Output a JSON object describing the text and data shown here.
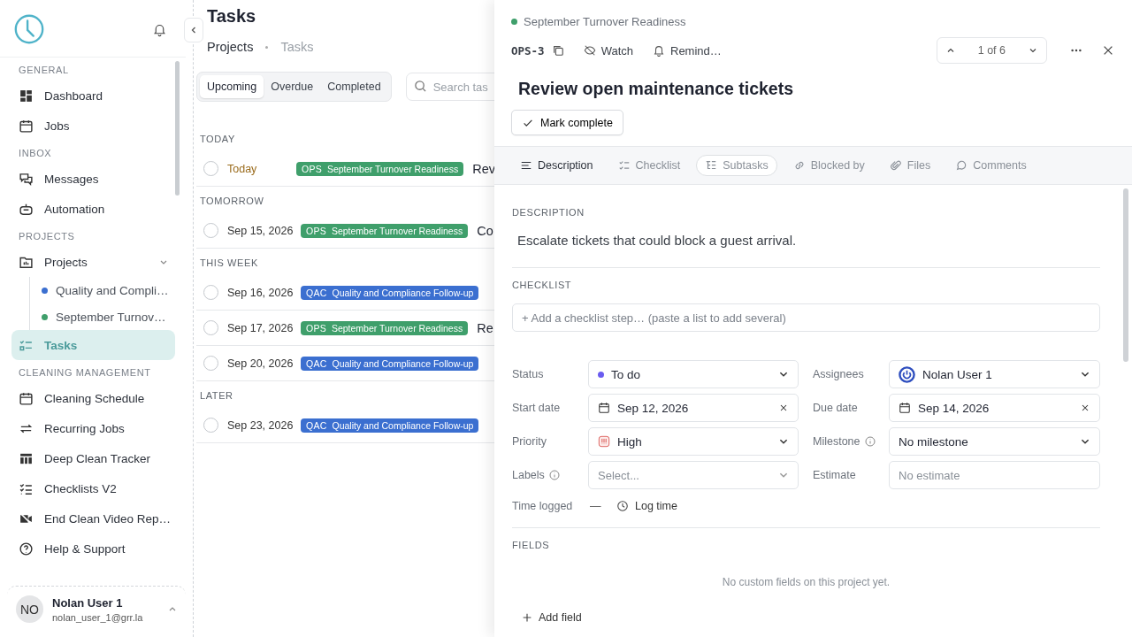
{
  "sidebar": {
    "sections": [
      {
        "heading": "GENERAL",
        "items": [
          {
            "label": "Dashboard",
            "selected": false
          },
          {
            "label": "Jobs",
            "selected": false
          }
        ]
      },
      {
        "heading": "INBOX",
        "items": [
          {
            "label": "Messages",
            "selected": false
          },
          {
            "label": "Automation",
            "selected": false
          }
        ]
      },
      {
        "heading": "PROJECTS",
        "items": [
          {
            "label": "Projects",
            "selected": false,
            "expanded": true,
            "children": [
              {
                "label": "Quality and Compli…",
                "color": "#3b6fd0",
                "selected": false
              },
              {
                "label": "September Turnov…",
                "color": "#3f9f6b",
                "selected": false
              }
            ]
          },
          {
            "label": "Tasks",
            "selected": true
          }
        ]
      },
      {
        "heading": "CLEANING MANAGEMENT",
        "items": [
          {
            "label": "Cleaning Schedule",
            "selected": false
          },
          {
            "label": "Recurring Jobs",
            "selected": false
          },
          {
            "label": "Deep Clean Tracker",
            "selected": false
          },
          {
            "label": "Checklists V2",
            "selected": false
          },
          {
            "label": "End Clean Video Rep…",
            "selected": false
          },
          {
            "label": "Help & Support",
            "selected": false
          }
        ]
      }
    ],
    "user": {
      "initials": "NO",
      "name": "Nolan User 1",
      "email": "nolan_user_1@grr.la"
    }
  },
  "main": {
    "title": "Tasks",
    "breadcrumb": [
      {
        "label": "Projects",
        "selected": false
      },
      {
        "label": "Tasks",
        "selected": true
      }
    ],
    "tabs": [
      {
        "label": "Upcoming",
        "selected": true
      },
      {
        "label": "Overdue",
        "selected": false
      },
      {
        "label": "Completed",
        "selected": false
      }
    ],
    "search": {
      "placeholder": "Search tas"
    },
    "groups": [
      {
        "heading": "TODAY",
        "rows": [
          {
            "checked": false,
            "date": "Today",
            "kind": "today",
            "tag": {
              "code": "OPS",
              "project": "September Turnover Readiness",
              "color": "#3f9f6b"
            },
            "title": "Rev"
          }
        ]
      },
      {
        "heading": "TOMORROW",
        "rows": [
          {
            "checked": false,
            "date": "Sep 15, 2026",
            "kind": "date",
            "tag": {
              "code": "OPS",
              "project": "September Turnover Readiness",
              "color": "#3f9f6b"
            },
            "title": "Co"
          }
        ]
      },
      {
        "heading": "THIS WEEK",
        "rows": [
          {
            "checked": false,
            "date": "Sep 16, 2026",
            "kind": "date",
            "tag": {
              "code": "QAC",
              "project": "Quality and Compliance Follow-up",
              "color": "#3b6fd0"
            }
          },
          {
            "checked": false,
            "date": "Sep 17, 2026",
            "kind": "date",
            "tag": {
              "code": "OPS",
              "project": "September Turnover Readiness",
              "color": "#3f9f6b"
            },
            "title": "Re"
          },
          {
            "checked": false,
            "date": "Sep 20, 2026",
            "kind": "date",
            "tag": {
              "code": "QAC",
              "project": "Quality and Compliance Follow-up",
              "color": "#3b6fd0"
            }
          }
        ]
      },
      {
        "heading": "LATER",
        "rows": [
          {
            "checked": false,
            "date": "Sep 23, 2026",
            "kind": "date",
            "tag": {
              "code": "QAC",
              "project": "Quality and Compliance Follow-up",
              "color": "#3b6fd0"
            }
          }
        ]
      }
    ]
  },
  "detail": {
    "project": {
      "name": "September Turnover Readiness",
      "color": "#3f9f6b"
    },
    "key": "OPS-3",
    "watch": "Watch",
    "remind": "Remind…",
    "pager": "1 of 6",
    "title": "Review open maintenance tickets",
    "complete_button": "Mark complete",
    "tabs": [
      {
        "label": "Description",
        "selected": true,
        "focused": false
      },
      {
        "label": "Checklist",
        "selected": false,
        "focused": false
      },
      {
        "label": "Subtasks",
        "selected": false,
        "focused": true
      },
      {
        "label": "Blocked by",
        "selected": false,
        "focused": false
      },
      {
        "label": "Files",
        "selected": false,
        "focused": false
      },
      {
        "label": "Comments",
        "selected": false,
        "focused": false
      }
    ],
    "description": {
      "heading": "DESCRIPTION",
      "text": "Escalate tickets that could block a guest arrival."
    },
    "checklist": {
      "heading": "CHECKLIST",
      "placeholder": "+ Add a checklist step… (paste a list to add several)"
    },
    "properties": [
      {
        "label": "Status",
        "info": false,
        "kind": "status",
        "value": "To do",
        "color": "#6a5cf0"
      },
      {
        "label": "Assignees",
        "info": false,
        "kind": "person",
        "value": "Nolan User 1"
      },
      {
        "label": "Start date",
        "info": false,
        "kind": "date",
        "value": "Sep 12, 2026"
      },
      {
        "label": "Due date",
        "info": false,
        "kind": "date",
        "value": "Sep 14, 2026"
      },
      {
        "label": "Priority",
        "info": false,
        "kind": "priority",
        "value": "High"
      },
      {
        "label": "Milestone",
        "info": true,
        "kind": "select",
        "value": "No milestone"
      },
      {
        "label": "Labels",
        "info": true,
        "kind": "select",
        "placeholder": "Select..."
      },
      {
        "label": "Estimate",
        "info": false,
        "kind": "text",
        "placeholder": "No estimate"
      }
    ],
    "time_logged": {
      "label": "Time logged",
      "value": "—",
      "button": "Log time"
    },
    "fields": {
      "heading": "FIELDS",
      "empty": "No custom fields on this project yet.",
      "button": "Add field"
    }
  }
}
